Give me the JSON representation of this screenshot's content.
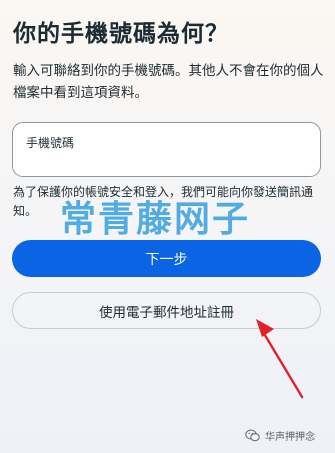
{
  "header": {
    "title": "你的手機號碼為何？",
    "subtitle": "輸入可聯絡到你的手機號碼。其他人不會在你的個人檔案中看到這項資料。"
  },
  "phone_field": {
    "label": "手機號碼",
    "value": ""
  },
  "help_text": "為了保護你的帳號安全和登入，我們可能向你發送簡訊通知。",
  "buttons": {
    "next_label": "下一步",
    "email_signup_label": "使用電子郵件地址註冊"
  },
  "overlay": {
    "watermark": "常青藤网子",
    "source_label": "华声押押念"
  },
  "colors": {
    "primary": "#0a64e3",
    "annotation_arrow": "#e0212b",
    "watermark": "#2296dc"
  },
  "icons": {
    "source": "wechat-icon"
  }
}
